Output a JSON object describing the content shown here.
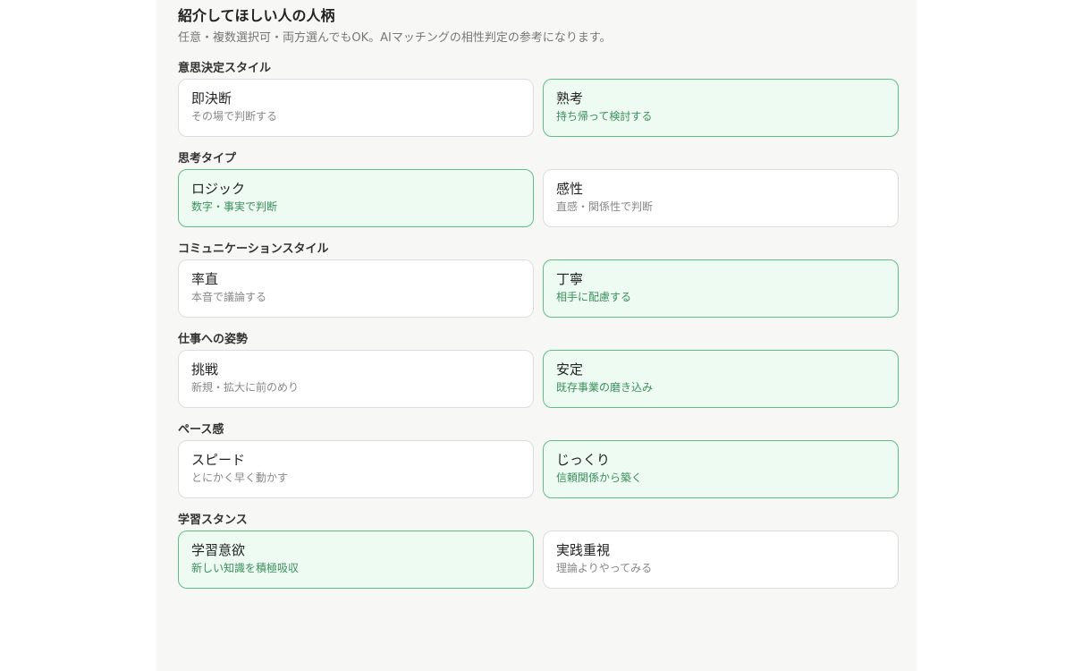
{
  "header": {
    "title": "紹介してほしい人の人柄",
    "subtitle": "任意・複数選択可・両方選んでもOK。AIマッチングの相性判定の参考になります。"
  },
  "colors": {
    "selected_border": "#62bd84",
    "selected_background": "#eefbf2",
    "selected_desc": "#3a8f5c"
  },
  "groups": [
    {
      "label": "意思決定スタイル",
      "options": [
        {
          "title": "即決断",
          "desc": "その場で判断する",
          "selected": false
        },
        {
          "title": "熟考",
          "desc": "持ち帰って検討する",
          "selected": true
        }
      ]
    },
    {
      "label": "思考タイプ",
      "options": [
        {
          "title": "ロジック",
          "desc": "数字・事実で判断",
          "selected": true
        },
        {
          "title": "感性",
          "desc": "直感・関係性で判断",
          "selected": false
        }
      ]
    },
    {
      "label": "コミュニケーションスタイル",
      "options": [
        {
          "title": "率直",
          "desc": "本音で議論する",
          "selected": false
        },
        {
          "title": "丁寧",
          "desc": "相手に配慮する",
          "selected": true
        }
      ]
    },
    {
      "label": "仕事への姿勢",
      "options": [
        {
          "title": "挑戦",
          "desc": "新規・拡大に前のめり",
          "selected": false
        },
        {
          "title": "安定",
          "desc": "既存事業の磨き込み",
          "selected": true
        }
      ]
    },
    {
      "label": "ペース感",
      "options": [
        {
          "title": "スピード",
          "desc": "とにかく早く動かす",
          "selected": false
        },
        {
          "title": "じっくり",
          "desc": "信頼関係から築く",
          "selected": true
        }
      ]
    },
    {
      "label": "学習スタンス",
      "options": [
        {
          "title": "学習意欲",
          "desc": "新しい知識を積極吸収",
          "selected": true
        },
        {
          "title": "実践重視",
          "desc": "理論よりやってみる",
          "selected": false
        }
      ]
    }
  ]
}
